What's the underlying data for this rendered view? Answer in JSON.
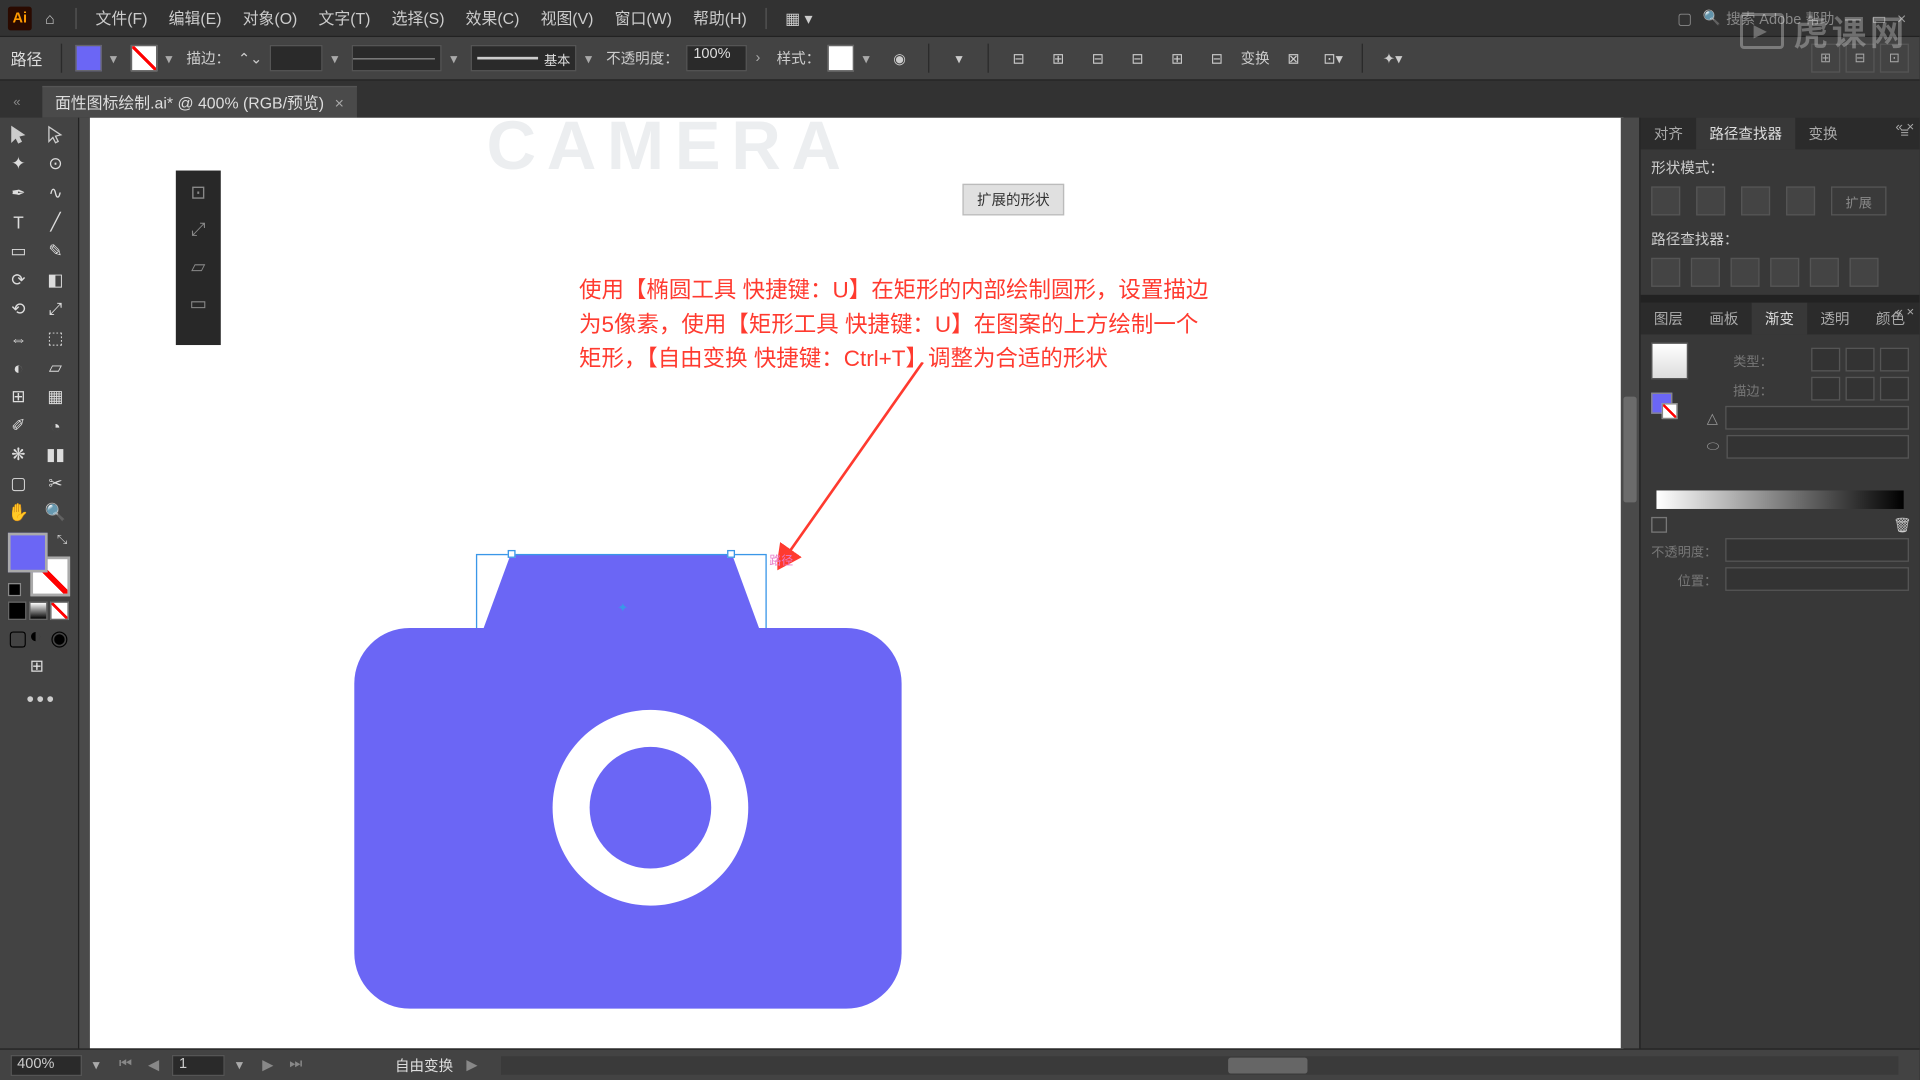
{
  "menubar": {
    "logo": "Ai",
    "items": [
      "文件(F)",
      "编辑(E)",
      "对象(O)",
      "文字(T)",
      "选择(S)",
      "效果(C)",
      "视图(V)",
      "窗口(W)",
      "帮助(H)"
    ],
    "search_placeholder": "搜索 Adobe 帮助"
  },
  "controlbar": {
    "object_type": "路径",
    "stroke_label": "描边：",
    "profile_label": "基本",
    "opacity_label": "不透明度：",
    "opacity_value": "100%",
    "style_label": "样式：",
    "transform_label": "变换"
  },
  "doctab": {
    "title": "面性图标绘制.ai* @ 400% (RGB/预览)"
  },
  "canvas": {
    "ghost": "CAMERA",
    "expand_btn": "扩展的形状",
    "annotation_lines": [
      "使用【椭圆工具 快捷键：U】在矩形的内部绘制圆形，设置描边",
      "为5像素，使用【矩形工具 快捷键：U】在图案的上方绘制一个",
      "矩形，【自由变换 快捷键：Ctrl+T】调整为合适的形状"
    ],
    "path_label": "路径"
  },
  "panels": {
    "align_tabs": [
      "对齐",
      "路径查找器",
      "变换"
    ],
    "shape_mode_label": "形状模式：",
    "expand_label": "扩展",
    "pathfinder_label": "路径查找器：",
    "gradient_tabs": [
      "图层",
      "画板",
      "渐变",
      "透明",
      "颜色"
    ],
    "type_label": "类型：",
    "stroke_label": "描边：",
    "opacity_label": "不透明度：",
    "position_label": "位置："
  },
  "statusbar": {
    "zoom": "400%",
    "artboard": "1",
    "tool": "自由变换"
  },
  "watermark": "虎课网",
  "icons": {
    "home": "⌂",
    "search": "🔍",
    "close": "×"
  },
  "colors": {
    "primary_fill": "#6b66f5"
  }
}
